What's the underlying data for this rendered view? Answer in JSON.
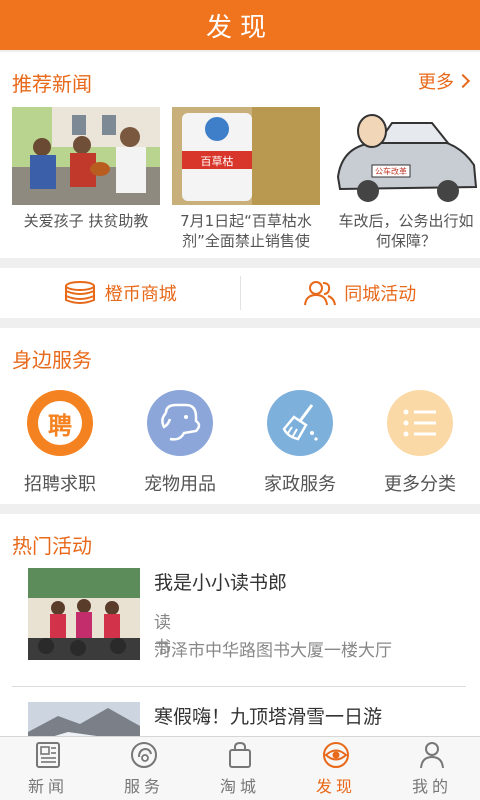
{
  "header": {
    "title": "发现"
  },
  "news": {
    "section_title": "推荐新闻",
    "more_label": "更多",
    "items": [
      {
        "caption": "关爱孩子 扶贫助教"
      },
      {
        "caption": "7月1日起“百草枯水剂”全面禁止销售使",
        "image_text": "百草枯"
      },
      {
        "caption": "车改后，公务出行如何保障？",
        "image_text": "公车改革"
      }
    ]
  },
  "quick_links": [
    {
      "label": "橙币商城",
      "icon": "coins-icon"
    },
    {
      "label": "同城活动",
      "icon": "people-icon"
    }
  ],
  "services": {
    "section_title": "身边服务",
    "items": [
      {
        "label": "招聘求职",
        "icon": "recruit-icon",
        "icon_text": "聘",
        "color": "#f58220"
      },
      {
        "label": "宠物用品",
        "icon": "dog-icon",
        "color": "#8ca6d9"
      },
      {
        "label": "家政服务",
        "icon": "broom-icon",
        "color": "#7eb0dc"
      },
      {
        "label": "更多分类",
        "icon": "list-icon",
        "color": "#fbd9a6"
      }
    ]
  },
  "events": {
    "section_title": "热门活动",
    "items": [
      {
        "title": "我是小小读书郎",
        "category": "读书",
        "location": "菏泽市中华路图书大厦一楼大厅"
      },
      {
        "title": "寒假嗨！九顶塔滑雪一日游",
        "category": "",
        "location": ""
      }
    ]
  },
  "tabbar": {
    "items": [
      {
        "label": "新闻",
        "icon": "newspaper-icon",
        "active": false
      },
      {
        "label": "服务",
        "icon": "service-icon",
        "active": false
      },
      {
        "label": "淘城",
        "icon": "shopping-bag-icon",
        "active": false
      },
      {
        "label": "发现",
        "icon": "eye-icon",
        "active": true
      },
      {
        "label": "我的",
        "icon": "user-icon",
        "active": false
      }
    ]
  },
  "colors": {
    "accent": "#f0731e",
    "background": "#efefef"
  }
}
